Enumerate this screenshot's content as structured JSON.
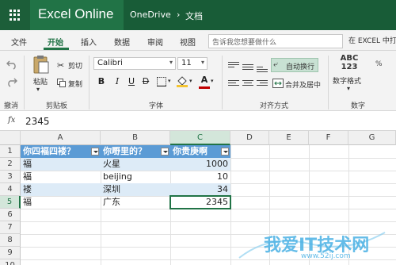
{
  "title_bar": {
    "app_name": "Excel Online",
    "breadcrumb_service": "OneDrive",
    "breadcrumb_separator": "›",
    "breadcrumb_folder": "文档"
  },
  "ribbon_tabs": {
    "items": [
      "文件",
      "开始",
      "插入",
      "数据",
      "审阅",
      "视图"
    ],
    "active": "开始",
    "tell_me_placeholder": "告诉我您想要做什么",
    "open_in_excel": "在 EXCEL 中打"
  },
  "ribbon": {
    "undo": {
      "group_label": "撤消"
    },
    "clipboard": {
      "paste_label": "粘贴",
      "cut_label": "剪切",
      "copy_label": "复制",
      "group_label": "剪贴板"
    },
    "font": {
      "font_name": "Calibri",
      "font_size": "11",
      "bold": "B",
      "italic": "I",
      "underline": "U",
      "strikethrough": "D",
      "font_color_glyph": "A",
      "group_label": "字体"
    },
    "alignment": {
      "wrap_text_label": "自动换行",
      "merge_center_label": "合并及居中",
      "group_label": "对齐方式"
    },
    "number": {
      "format_preview": "ABC\n123",
      "format_preview_line1": "ABC",
      "format_preview_line2": "123",
      "format_label": "数字格式",
      "group_label": "数字"
    }
  },
  "formula_bar": {
    "fx_label": "fx",
    "value": "2345"
  },
  "sheet": {
    "columns": [
      "A",
      "B",
      "C",
      "D",
      "E",
      "F",
      "G"
    ],
    "selected_column": "C",
    "rows": [
      "1",
      "2",
      "3",
      "4",
      "5",
      "6",
      "7",
      "8",
      "9",
      "10"
    ],
    "selected_row": "5",
    "table_headers": [
      "你四褔四褛？",
      "你嘢里的？",
      "你贵庚啊"
    ],
    "table_rows": [
      [
        "褔",
        "火星",
        "1000"
      ],
      [
        "褔",
        "beijing",
        "10"
      ],
      [
        "褛",
        "深圳",
        "34"
      ],
      [
        "褔",
        "广东",
        "2345"
      ]
    ]
  },
  "watermark": {
    "text": "我爱IT技术网",
    "url": "www.52ij.com"
  },
  "colors": {
    "brand_green": "#217346",
    "table_header_blue": "#5b9bd5",
    "table_band": "#ddebf7"
  }
}
